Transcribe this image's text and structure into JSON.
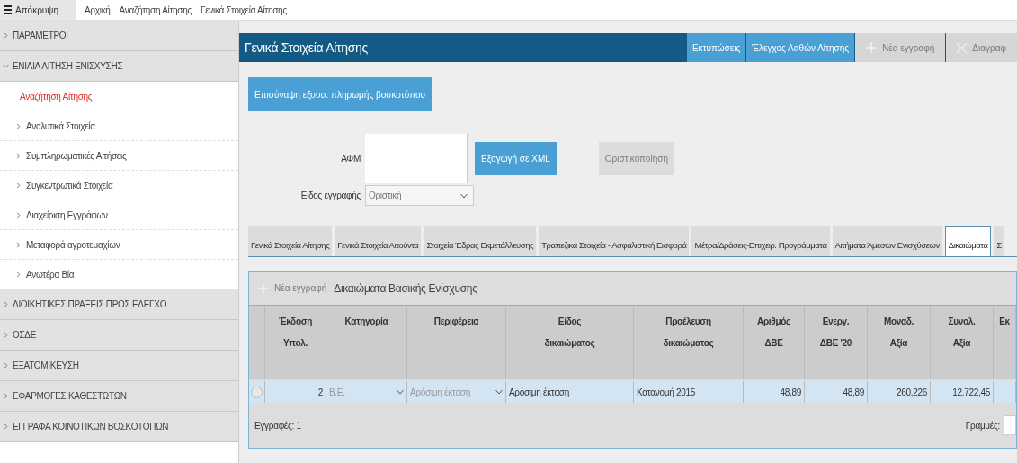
{
  "top_nav": {
    "hide_button": "Απόκρυψη",
    "links": [
      "Αρχική",
      "Αναζήτηση Αίτησης",
      "Γενικά Στοιχεία Αίτησης"
    ]
  },
  "sidebar": {
    "items": [
      {
        "label": "ΠΑΡΑΜΕΤΡΟΙ",
        "expanded": false
      },
      {
        "label": "ΕΝΙΑΙΑ ΑΙΤΗΣΗ ΕΝΙΣΧΥΣΗΣ",
        "expanded": true,
        "children": [
          {
            "label": "Αναζήτηση Αίτησης",
            "kind": "leaf",
            "selected": true
          },
          {
            "label": "Αναλυτικά Στοιχεία",
            "kind": "group",
            "selected": false
          },
          {
            "label": "Συμπληρωματικές Αιτήσεις",
            "kind": "group",
            "selected": false
          },
          {
            "label": "Συγκεντρωτικά Στοιχεία",
            "kind": "group",
            "selected": false
          },
          {
            "label": "Διαχείριση Εγγράφων",
            "kind": "group",
            "selected": false
          },
          {
            "label": "Μεταφορά αγροτεμαχίων",
            "kind": "group",
            "selected": false
          },
          {
            "label": "Ανωτέρα Βία",
            "kind": "group",
            "selected": false
          }
        ]
      },
      {
        "label": "ΔΙΟΙΚΗΤΙΚΕΣ ΠΡΑΞΕΙΣ ΠΡΟΣ ΕΛΕΓΧΟ",
        "expanded": false
      },
      {
        "label": "ΟΣΔΕ",
        "expanded": false
      },
      {
        "label": "ΕΞΑΤΟΜΙΚΕΥΣΗ",
        "expanded": false
      },
      {
        "label": "ΕΦΑΡΜΟΓΕΣ ΚΑΘΕΣΤΩΤΩΝ",
        "expanded": false
      },
      {
        "label": "ΕΓΓΡΑΦΑ ΚΟΙΝΟΤΙΚΩΝ ΒΟΣΚΟΤΟΠΩΝ",
        "expanded": false
      }
    ]
  },
  "panel": {
    "title": "Γενικά Στοιχεία Αίτησης",
    "buttons": [
      {
        "label": "Εκτυπώσεις",
        "kind": "plain",
        "disabled": false
      },
      {
        "label": "Έλεγχος Λαθών Αίτησης",
        "kind": "plain",
        "disabled": false
      },
      {
        "label": "Νέα εγγραφή",
        "kind": "add",
        "disabled": true
      },
      {
        "label": "Διαγραφ",
        "kind": "delete",
        "disabled": true
      }
    ],
    "attach_button": "Επισύναψη εξουσ. πληρωμής βοσκοτόπου",
    "afm": {
      "label": "ΑΦΜ"
    },
    "export_button": {
      "label": "Εξαγωγή σε XML",
      "disabled": false
    },
    "finalize_button": {
      "label": "Οριστικοποίηση",
      "disabled": true
    },
    "record_type": {
      "label": "Είδος εγγραφής",
      "value": "Οριστική"
    }
  },
  "tabs": [
    {
      "label": "Γενικά Στοιχεία Αίτησης",
      "selected": false
    },
    {
      "label": "Γενικά Στοιχεία Αιτούντα",
      "selected": false
    },
    {
      "label": "Στοιχεία Έδρας Εκμετάλλευσης",
      "selected": false
    },
    {
      "label": "Τραπεζικά Στοιχεία - Ασφαλιστική Εισφορά",
      "selected": false
    },
    {
      "label": "Μέτρα/Δράσεις-Επιχειρ. Προγράμματα",
      "selected": false
    },
    {
      "label": "Αιτήματα Άμεσων Ενισχύσεων",
      "selected": false
    },
    {
      "label": "Δικαιώματα",
      "selected": true
    },
    {
      "label": "Σ",
      "selected": false
    }
  ],
  "grid": {
    "new_button": {
      "label": "Νέα εγγραφή",
      "disabled": true
    },
    "title": "Δικαιώματα Βασικής Ενίσχυσης",
    "columns": [
      "Έκδοση\nΥπολ.",
      "Κατηγορία",
      "Περιφέρεια",
      "Είδος\nδικαιώματος",
      "Προέλευση\nδικαιώματος",
      "Αριθμός\nΔΒΕ",
      "Ενεργ.\nΔΒΕ '20",
      "Μοναδ.\nΑξία",
      "Συνολ.\nΑξία",
      "Εκ"
    ],
    "rows": [
      {
        "selected": false,
        "cells": [
          {
            "kind": "num",
            "text": "2"
          },
          {
            "kind": "select",
            "text": "Β.Ε."
          },
          {
            "kind": "select",
            "text": "Αρόσιμη έκταση"
          },
          {
            "kind": "text",
            "text": "Αρόσιμη έκταση"
          },
          {
            "kind": "text",
            "text": "Κατανομή 2015"
          },
          {
            "kind": "num",
            "text": "48,89"
          },
          {
            "kind": "num",
            "text": "48,89"
          },
          {
            "kind": "num",
            "text": "260,226"
          },
          {
            "kind": "num",
            "text": "12.722,45"
          },
          {
            "kind": "empty"
          }
        ]
      }
    ],
    "record_count": "Εγγραφές: 1",
    "rows_label": "Γραμμές:"
  }
}
